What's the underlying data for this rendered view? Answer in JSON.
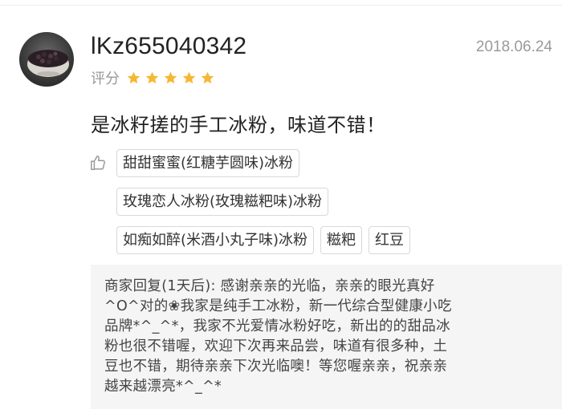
{
  "review": {
    "username": "lKz655040342",
    "date": "2018.06.24",
    "rating_label": "评分",
    "rating": 5,
    "rating_max": 5,
    "star_color": "#f7b733",
    "text": "是冰籽搓的手工冰粉，味道不错！",
    "like_icon": "thumbs-up-icon",
    "tags": [
      [
        "甜甜蜜蜜(红糖芋圆味)冰粉"
      ],
      [
        "玫瑰恋人冰粉(玫瑰糍粑味)冰粉"
      ],
      [
        "如痴如醉(米酒小丸子味)冰粉",
        "糍粑",
        "红豆"
      ]
    ]
  },
  "merchant_reply": {
    "lines": [
      "商家回复(1天后): 感谢亲亲的光临，亲亲的眼光真好",
      "^O^对的❀我家是纯手工冰粉，新一代综合型健康小吃",
      "品牌*^_^*，我家不光爱情冰粉好吃，新出的的甜品冰",
      "粉也很不错喔，欢迎下次再来品尝，味道有很多种，土",
      "豆也不错，期待亲亲下次光临噢！等您喔亲亲，祝亲亲",
      "越来越漂亮*^_^*"
    ]
  }
}
